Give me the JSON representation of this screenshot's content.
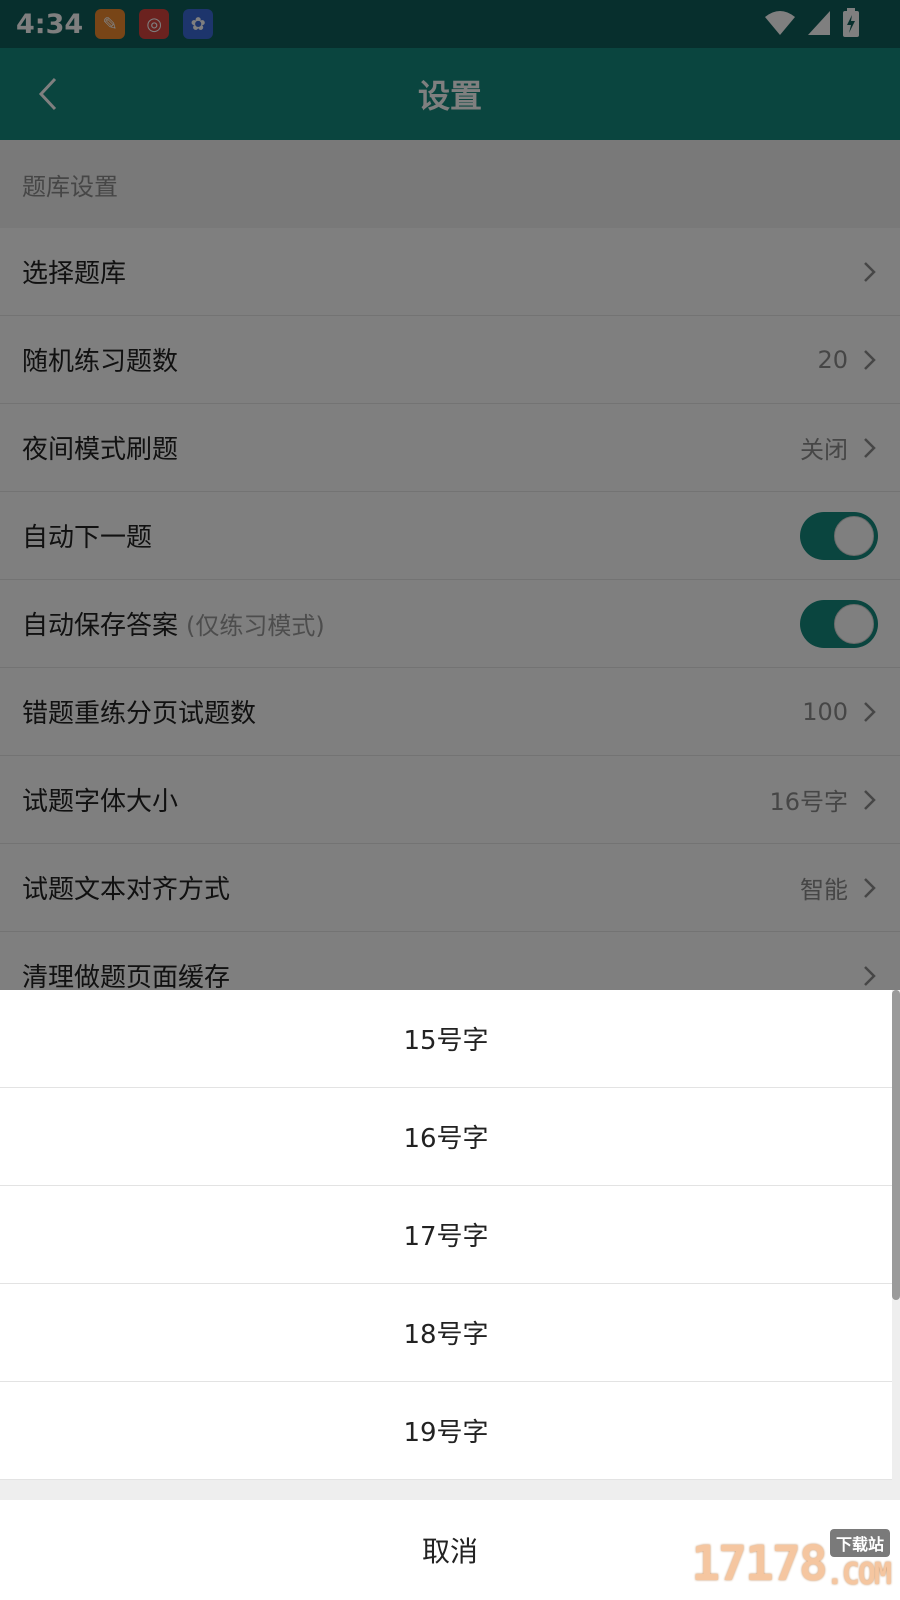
{
  "status_bar": {
    "time": "4:34",
    "app_icons": [
      {
        "name": "notification-app-icon-1",
        "color": "#f08a2e"
      },
      {
        "name": "notification-app-icon-2",
        "color": "#d6453f"
      },
      {
        "name": "notification-app-icon-3",
        "color": "#3b6ad8"
      }
    ],
    "icons": [
      "wifi-icon",
      "signal-icon",
      "battery-charging-icon"
    ]
  },
  "app_bar": {
    "title": "设置",
    "back_icon": "chevron-left-icon",
    "color": "#148a7e"
  },
  "section": {
    "header": "题库设置"
  },
  "settings": [
    {
      "label": "选择题库",
      "value": "",
      "type": "nav"
    },
    {
      "label": "随机练习题数",
      "value": "20",
      "type": "nav"
    },
    {
      "label": "夜间模式刷题",
      "value": "关闭",
      "type": "nav"
    },
    {
      "label": "自动下一题",
      "type": "toggle",
      "on": true
    },
    {
      "label": "自动保存答案",
      "hint": "(仅练习模式)",
      "type": "toggle",
      "on": true
    },
    {
      "label": "错题重练分页试题数",
      "value": "100",
      "type": "nav"
    },
    {
      "label": "试题字体大小",
      "value": "16号字",
      "type": "nav"
    },
    {
      "label": "试题文本对齐方式",
      "value": "智能",
      "type": "nav"
    },
    {
      "label": "清理做题页面缓存",
      "value": "",
      "type": "nav"
    }
  ],
  "bottom_sheet": {
    "options": [
      "15号字",
      "16号字",
      "17号字",
      "18号字",
      "19号字"
    ],
    "cancel_label": "取消"
  },
  "watermark": {
    "digits": "17178",
    "small": "下载站",
    "suffix": ".COM"
  }
}
